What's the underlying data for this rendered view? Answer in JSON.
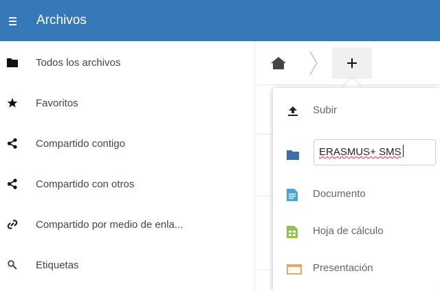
{
  "header": {
    "title": "Archivos",
    "background": "#3579b8"
  },
  "sidebar": {
    "items": [
      {
        "label": "Todos los archivos",
        "icon": "folder-icon"
      },
      {
        "label": "Favoritos",
        "icon": "star-icon"
      },
      {
        "label": "Compartido contigo",
        "icon": "share-icon"
      },
      {
        "label": "Compartido con otros",
        "icon": "share-icon"
      },
      {
        "label": "Compartido por medio de enla...",
        "icon": "link-icon"
      },
      {
        "label": "Etiquetas",
        "icon": "tag-icon"
      }
    ]
  },
  "breadcrumb": {
    "home_icon": "home-icon",
    "new_button_icon": "plus-icon"
  },
  "new_menu": {
    "upload_label": "Subir",
    "folder_name_value": "ERASMUS+ SMS",
    "document_label": "Documento",
    "spreadsheet_label": "Hoja de cálculo",
    "presentation_label": "Presentación"
  },
  "colors": {
    "accent": "#3579b8",
    "folder": "#3c6ea8",
    "document": "#4aa3df",
    "spreadsheet": "#8fc34a",
    "presentation": "#f2a35b"
  }
}
